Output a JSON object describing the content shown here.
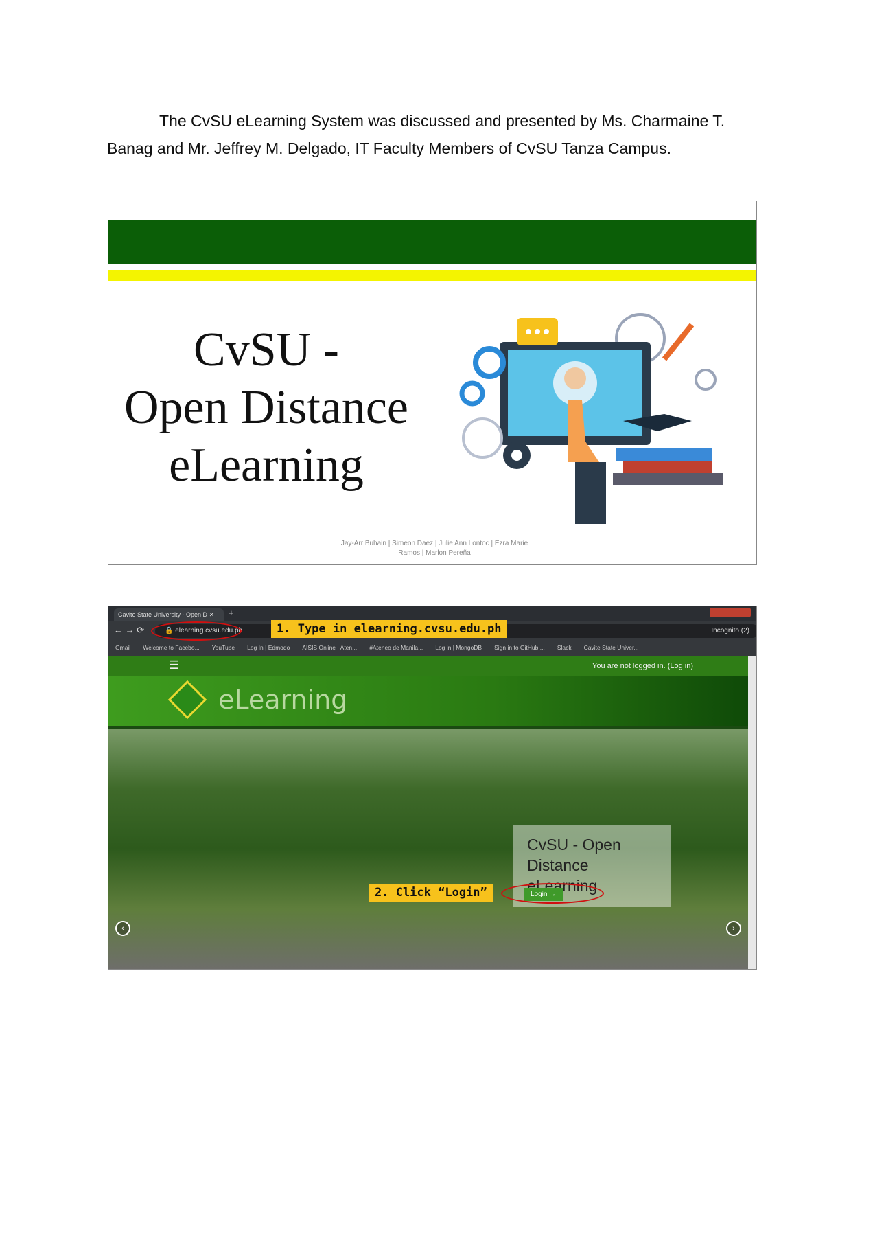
{
  "paragraph": {
    "line1": "The CvSU eLearning System was discussed and presented by Ms. Charmaine T.",
    "line2": "Banag and Mr. Jeffrey M. Delgado, IT Faculty Members of CvSU Tanza Campus."
  },
  "slide1": {
    "title_line1": "CvSU -",
    "title_line2": "Open Distance",
    "title_line3": "eLearning",
    "credits_line1": "Jay-Arr Buhain | Simeon Daez | Julie Ann Lontoc | Ezra Marie",
    "credits_line2": "Ramos | Marlon Pereña"
  },
  "slide2": {
    "tab_title": "Cavite State University - Open D",
    "url": "elearning.cvsu.edu.ph",
    "incognito": "Incognito (2)",
    "bookmarks": [
      "Gmail",
      "Welcome to Facebo...",
      "YouTube",
      "Log In | Edmodo",
      "AISIS Online : Aten...",
      "#Ateneo de Manila...",
      "Log in | MongoDB",
      "Sign in to GitHub ...",
      "Slack",
      "Cavite State Univer..."
    ],
    "login_status": "You are not logged in. (Log in)",
    "logo_text": "eLearning",
    "hero_title_line1": "CvSU - Open",
    "hero_title_line2": "Distance eLearning",
    "login_button": "Login →",
    "callout1": "1. Type in elearning.cvsu.edu.ph",
    "callout2": "2. Click “Login”"
  }
}
